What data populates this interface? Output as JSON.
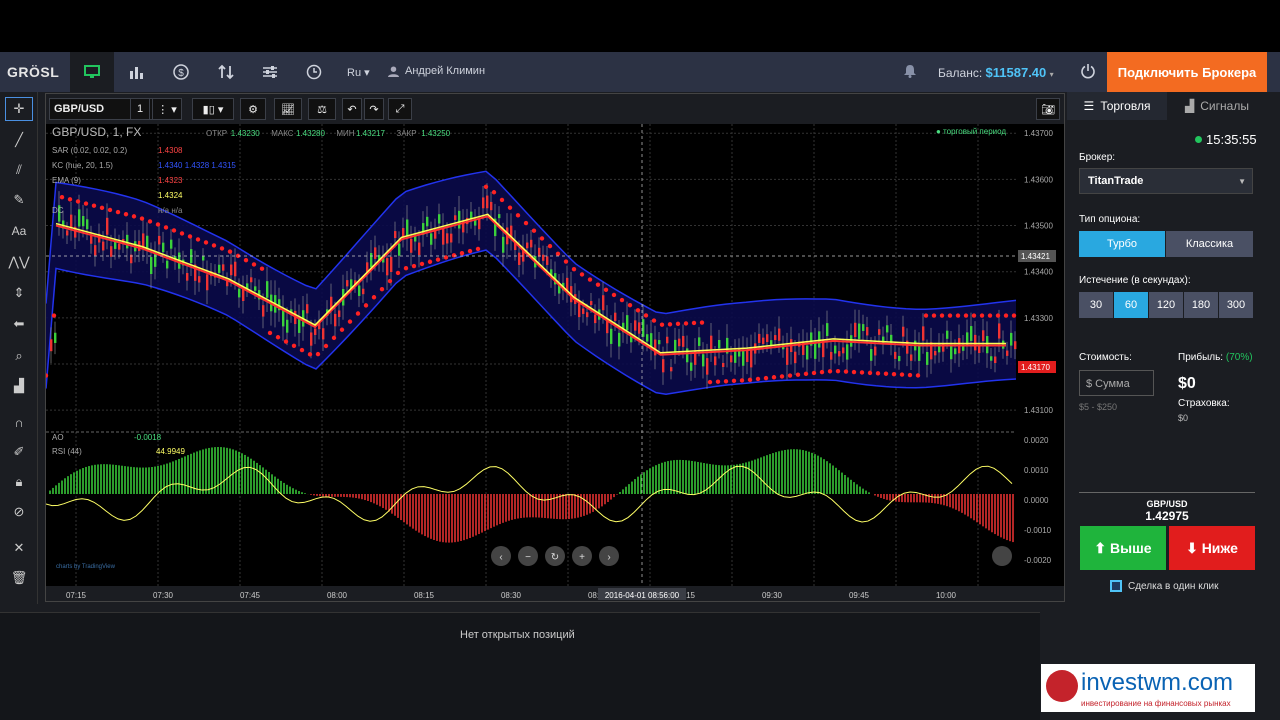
{
  "header": {
    "logo": "GRÖSL",
    "lang": "Ru",
    "user_name": "Андрей Климин",
    "balance_label": "Баланс:",
    "balance_value": "$11587.40",
    "connect_broker": "Подключить Брокера"
  },
  "chart_toolbar": {
    "symbol": "GBP/USD",
    "interval": "1"
  },
  "chart": {
    "title": "GBP/USD, 1, FX",
    "ohlc": {
      "open_label": "ОТКР",
      "open": "1.43230",
      "high_label": "МАКС",
      "high": "1.43280",
      "low_label": "МИН",
      "low": "1.43217",
      "close_label": "ЗАКР",
      "close": "1.43250"
    },
    "indicators": [
      {
        "name": "SAR (0.02, 0.02, 0.2)",
        "value": "1.4308",
        "color": "#ff4444"
      },
      {
        "name": "KC (hue, 20, 1.5)",
        "value": "1.4340  1.4328  1.4315",
        "color": "#3355ff"
      },
      {
        "name": "EMA (9)",
        "value": "1.4323",
        "color": "#ff4444"
      },
      {
        "name": "",
        "value": "1.4324",
        "color": "#ffff66"
      },
      {
        "name": "DC",
        "value": "н/а  н/а",
        "color": "#888888"
      }
    ],
    "period_label": "торговый период",
    "price_ticks": [
      "1.43700",
      "1.43600",
      "1.43500",
      "1.43400",
      "1.43300",
      "1.43200",
      "1.43100"
    ],
    "crosshair_price": "1.43421",
    "last_price": "1.43170",
    "osc_ticks": [
      "0.0020",
      "0.0010",
      "0.0000",
      "-0.0010",
      "-0.0020"
    ],
    "ao_label": "AO",
    "ao_value": "-0.0018",
    "rsi_label": "RSI (44)",
    "rsi_value": "44.9949",
    "time_ticks": [
      "07:15",
      "07:30",
      "07:45",
      "08:00",
      "08:15",
      "08:30",
      "08:45",
      "09:15",
      "09:30",
      "09:45",
      "10:00"
    ],
    "crosshair_time": "2016-04-01 08:56:00",
    "watermark": "charts by TradingView"
  },
  "chart_data": {
    "type": "line",
    "title": "GBP/USD, 1, FX",
    "ylim": [
      1.4307,
      1.4372
    ],
    "x": [
      "07:15",
      "07:30",
      "07:45",
      "08:00",
      "08:15",
      "08:30",
      "08:45",
      "09:00",
      "09:15",
      "09:30",
      "09:45",
      "10:00"
    ],
    "series": [
      {
        "name": "EMA (9)",
        "values": [
          1.435,
          1.4345,
          1.4338,
          1.4328,
          1.4347,
          1.4352,
          1.4334,
          1.4322,
          1.4323,
          1.4325,
          1.4324,
          1.4324
        ]
      }
    ],
    "grid": true
  },
  "bottom": {
    "no_positions": "Нет открытых позиций"
  },
  "ad": {
    "brand": "investwm.com",
    "tagline": "инвестирование на финансовых рынках"
  },
  "panel": {
    "tab_trading": "Торговля",
    "tab_signals": "Сигналы",
    "time": "15:35:55",
    "broker_label": "Брокер:",
    "broker_value": "TitanTrade",
    "option_type_label": "Тип опциона:",
    "option_turbo": "Турбо",
    "option_classic": "Классика",
    "expiry_label": "Истечение (в секундах):",
    "expiry_options": [
      "30",
      "60",
      "120",
      "180",
      "300"
    ],
    "cost_label": "Стоимость:",
    "profit_label": "Прибыль:",
    "profit_pct": "(70%)",
    "sum_placeholder": "$ Сумма",
    "range": "$5 - $250",
    "profit_value": "$0",
    "insurance_label": "Страховка:",
    "insurance_value": "$0",
    "pair": "GBP/USD",
    "pair_price": "1.42975",
    "btn_up": "Выше",
    "btn_down": "Ниже",
    "one_click": "Сделка в один клик"
  },
  "colors": {
    "accent": "#4fc3f7",
    "up": "#22c55e",
    "down": "#e11d1d",
    "broker_btn": "#f36b21"
  }
}
